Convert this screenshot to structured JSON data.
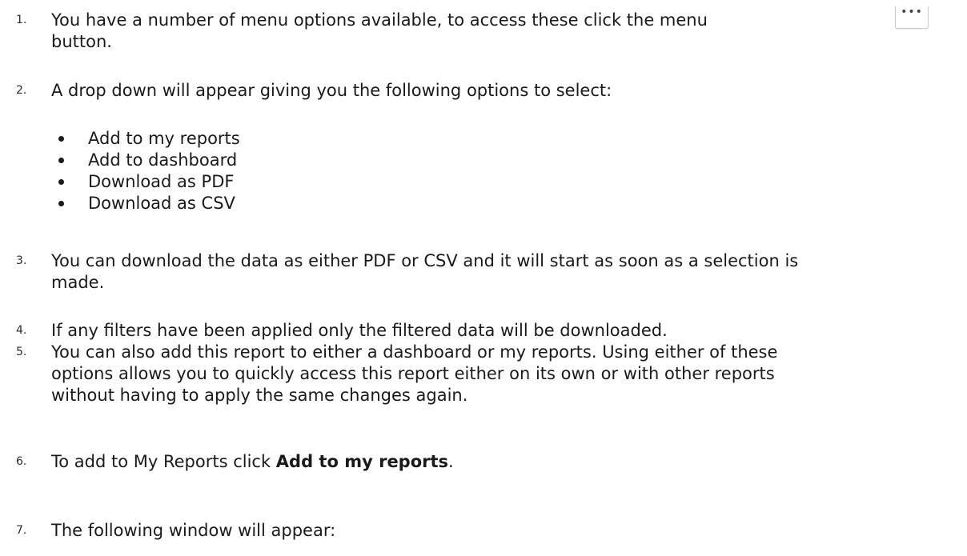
{
  "steps": [
    {
      "number": "1.",
      "line1": "You have a number of menu options available, to access these click the menu",
      "line2": "button.",
      "menu_icon": "more-horizontal-icon",
      "menu_glyph": "•••"
    },
    {
      "number": "2.",
      "text": "A drop down will appear giving you the following options to select:"
    },
    {
      "number": "3.",
      "line1": "You can download the data as either PDF or CSV and it will start as soon as a selection is",
      "line2": "made."
    },
    {
      "number": "4.",
      "text": "If any filters have been applied only the filtered data will be downloaded."
    },
    {
      "number": "5.",
      "line1": "You can also add this report to either a dashboard or my reports. Using either of these",
      "line2": "options allows you to quickly access this report either on its own or with other reports",
      "line3": "without having to apply the same changes again."
    },
    {
      "number": "6.",
      "prefix": "To add to My Reports click ",
      "bold": "Add to my reports",
      "suffix": "."
    },
    {
      "number": "7.",
      "text": "The following window will appear:"
    }
  ],
  "options": [
    "Add to my reports",
    "Add to dashboard",
    "Download as PDF",
    "Download as CSV"
  ]
}
